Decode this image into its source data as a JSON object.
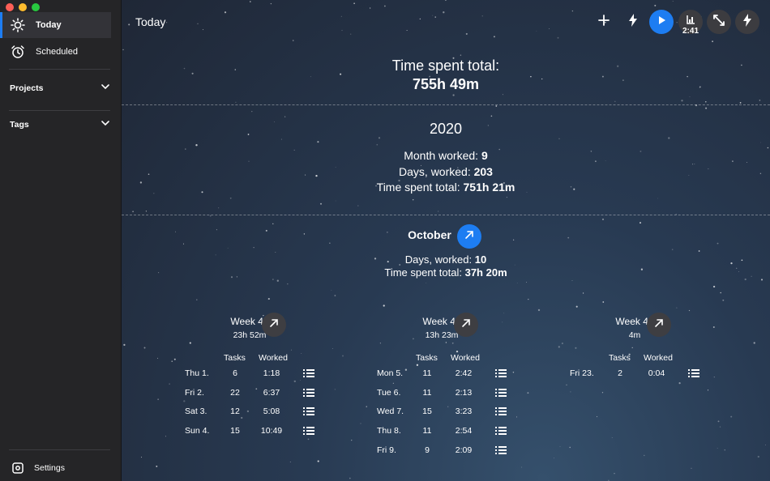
{
  "sidebar": {
    "nav": [
      {
        "label": "Today",
        "icon": "sun-icon",
        "active": true
      },
      {
        "label": "Scheduled",
        "icon": "alarm-clock-icon",
        "active": false
      }
    ],
    "sections": [
      {
        "label": "Projects",
        "icon": "chevron-down-icon"
      },
      {
        "label": "Tags",
        "icon": "chevron-down-icon"
      }
    ],
    "settings_label": "Settings"
  },
  "header": {
    "title": "Today",
    "toolbar": {
      "add_icon": "plus-icon",
      "quick_icon": "lightning-icon",
      "play_icon": "play-icon",
      "timer_text": "2:41",
      "expand_icon": "expand-icon",
      "flash_icon": "lightning-icon"
    }
  },
  "stats": {
    "total_label": "Time spent total:",
    "total_value": "755h 49m",
    "year": {
      "title": "2020",
      "month_label": "Month worked: ",
      "month_value": "9",
      "days_label": "Days, worked: ",
      "days_value": "203",
      "time_label": "Time spent total: ",
      "time_value": "751h 21m"
    },
    "month": {
      "title": "October",
      "days_label": "Days, worked: ",
      "days_value": "10",
      "time_label": "Time spent total: ",
      "time_value": "37h 20m"
    },
    "col_tasks": "Tasks",
    "col_worked": "Worked",
    "weeks": [
      {
        "name": "Week 40",
        "time": "23h 52m",
        "rows": [
          {
            "day": "Thu 1.",
            "tasks": "6",
            "worked": "1:18"
          },
          {
            "day": "Fri 2.",
            "tasks": "22",
            "worked": "6:37"
          },
          {
            "day": "Sat 3.",
            "tasks": "12",
            "worked": "5:08"
          },
          {
            "day": "Sun 4.",
            "tasks": "15",
            "worked": "10:49"
          }
        ]
      },
      {
        "name": "Week 41",
        "time": "13h 23m",
        "rows": [
          {
            "day": "Mon 5.",
            "tasks": "11",
            "worked": "2:42"
          },
          {
            "day": "Tue 6.",
            "tasks": "11",
            "worked": "2:13"
          },
          {
            "day": "Wed 7.",
            "tasks": "15",
            "worked": "3:23"
          },
          {
            "day": "Thu 8.",
            "tasks": "11",
            "worked": "2:54"
          },
          {
            "day": "Fri 9.",
            "tasks": "9",
            "worked": "2:09"
          }
        ]
      },
      {
        "name": "Week 43",
        "time": "4m",
        "rows": [
          {
            "day": "Fri 23.",
            "tasks": "2",
            "worked": "0:04"
          }
        ]
      }
    ]
  },
  "colors": {
    "accent": "#1d7df2",
    "sidebar": "#252527"
  }
}
